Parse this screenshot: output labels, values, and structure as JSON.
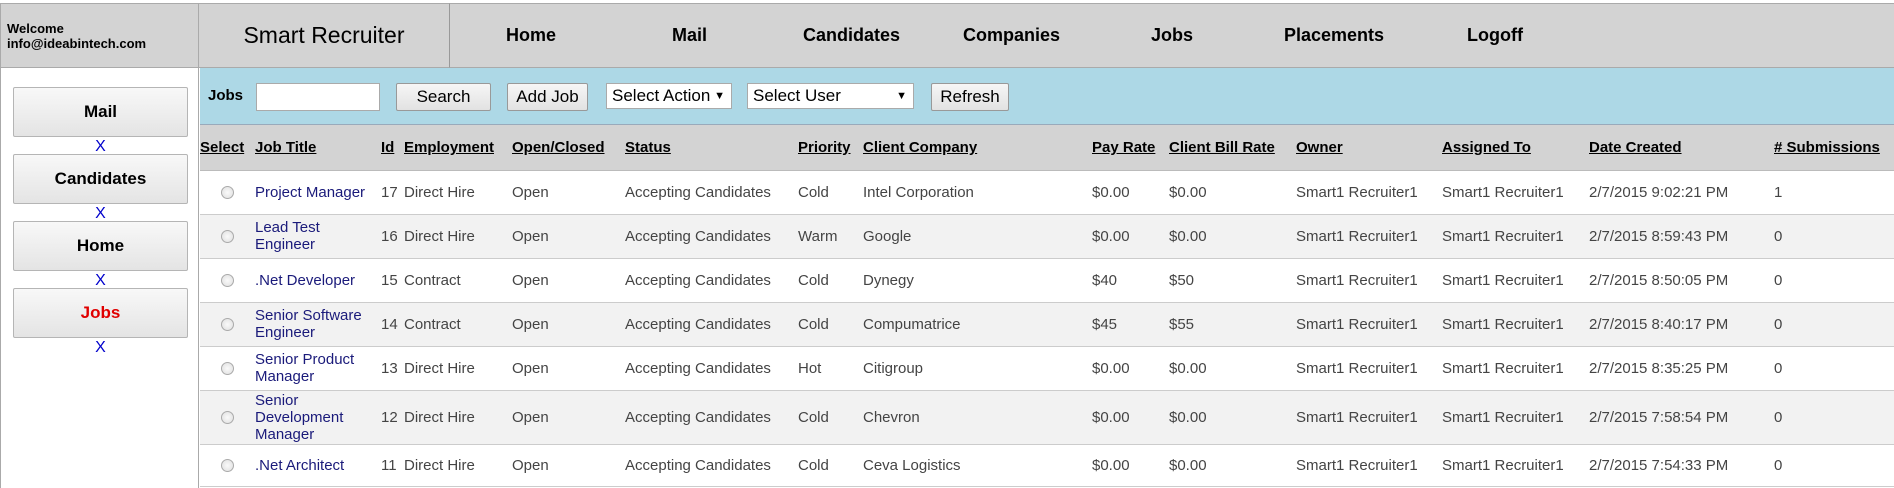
{
  "welcome": {
    "line1": "Welcome",
    "line2": "info@ideabintech.com"
  },
  "brand": "Smart Recruiter",
  "topnav": [
    "Home",
    "Mail",
    "Candidates",
    "Companies",
    "Jobs",
    "Placements",
    "Logoff"
  ],
  "sidebar": {
    "items": [
      {
        "label": "Mail",
        "close": "X"
      },
      {
        "label": "Candidates",
        "close": "X"
      },
      {
        "label": "Home",
        "close": "X"
      },
      {
        "label": "Jobs",
        "close": "X",
        "active": true
      }
    ]
  },
  "toolbar": {
    "label": "Jobs",
    "search_value": "",
    "search_label": "Search",
    "add_label": "Add Job",
    "action_select": "Select Action",
    "user_select": "Select User",
    "refresh_label": "Refresh"
  },
  "table": {
    "columns": [
      "Select",
      "Job Title",
      "Id",
      "Employment",
      "Open/Closed",
      "Status",
      "Priority",
      "Client Company",
      "Pay Rate",
      "Client Bill Rate",
      "Owner",
      "Assigned To",
      "Date Created",
      "# Submissions"
    ],
    "rows": [
      {
        "title": "Project Manager",
        "id": "17",
        "employment": "Direct Hire",
        "open": "Open",
        "status": "Accepting Candidates",
        "priority": "Cold",
        "company": "Intel Corporation",
        "pay": "$0.00",
        "bill": "$0.00",
        "owner": "Smart1 Recruiter1",
        "assigned": "Smart1 Recruiter1",
        "date": "2/7/2015 9:02:21 PM",
        "subs": "1"
      },
      {
        "title": "Lead Test Engineer",
        "id": "16",
        "employment": "Direct Hire",
        "open": "Open",
        "status": "Accepting Candidates",
        "priority": "Warm",
        "company": "Google",
        "pay": "$0.00",
        "bill": "$0.00",
        "owner": "Smart1 Recruiter1",
        "assigned": "Smart1 Recruiter1",
        "date": "2/7/2015 8:59:43 PM",
        "subs": "0"
      },
      {
        "title": ".Net Developer",
        "id": "15",
        "employment": "Contract",
        "open": "Open",
        "status": "Accepting Candidates",
        "priority": "Cold",
        "company": "Dynegy",
        "pay": "$40",
        "bill": "$50",
        "owner": "Smart1 Recruiter1",
        "assigned": "Smart1 Recruiter1",
        "date": "2/7/2015 8:50:05 PM",
        "subs": "0"
      },
      {
        "title": "Senior Software Engineer",
        "id": "14",
        "employment": "Contract",
        "open": "Open",
        "status": "Accepting Candidates",
        "priority": "Cold",
        "company": "Compumatrice",
        "pay": "$45",
        "bill": "$55",
        "owner": "Smart1 Recruiter1",
        "assigned": "Smart1 Recruiter1",
        "date": "2/7/2015 8:40:17 PM",
        "subs": "0"
      },
      {
        "title": "Senior Product Manager",
        "id": "13",
        "employment": "Direct Hire",
        "open": "Open",
        "status": "Accepting Candidates",
        "priority": "Hot",
        "company": "Citigroup",
        "pay": "$0.00",
        "bill": "$0.00",
        "owner": "Smart1 Recruiter1",
        "assigned": "Smart1 Recruiter1",
        "date": "2/7/2015 8:35:25 PM",
        "subs": "0"
      },
      {
        "title": "Senior Development Manager",
        "id": "12",
        "employment": "Direct Hire",
        "open": "Open",
        "status": "Accepting Candidates",
        "priority": "Cold",
        "company": "Chevron",
        "pay": "$0.00",
        "bill": "$0.00",
        "owner": "Smart1 Recruiter1",
        "assigned": "Smart1 Recruiter1",
        "date": "2/7/2015 7:58:54 PM",
        "subs": "0"
      },
      {
        "title": ".Net Architect",
        "id": "11",
        "employment": "Direct Hire",
        "open": "Open",
        "status": "Accepting Candidates",
        "priority": "Cold",
        "company": "Ceva Logistics",
        "pay": "$0.00",
        "bill": "$0.00",
        "owner": "Smart1 Recruiter1",
        "assigned": "Smart1 Recruiter1",
        "date": "2/7/2015 7:54:33 PM",
        "subs": "0"
      }
    ]
  },
  "colors": {
    "header_gray": "#d3d3d3",
    "toolbar_blue": "#add8e6",
    "active_red": "#e00000",
    "link_blue": "#0000cc"
  }
}
